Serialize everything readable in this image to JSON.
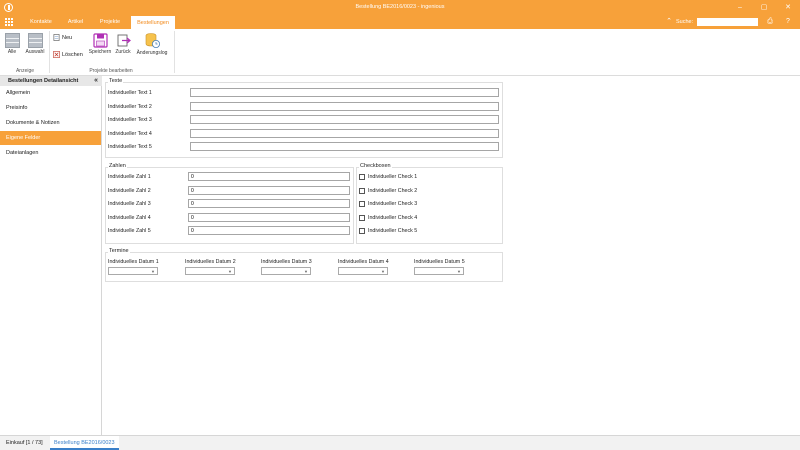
{
  "window": {
    "title": "Bestellung BE2016/0023 - ingenious",
    "controls": {
      "minimize": "‒",
      "maximize": "▢",
      "close": "✕"
    }
  },
  "menu": {
    "tabs": [
      {
        "label": "Kontakte",
        "icon": "contacts"
      },
      {
        "label": "Artikel",
        "icon": "articles"
      },
      {
        "label": "Projekte",
        "icon": "projects"
      },
      {
        "label": "Bestellungen",
        "icon": "orders",
        "active": true
      }
    ],
    "search_label": "Suche:",
    "search_value": "",
    "icons": {
      "collapse": "chevron-up-icon",
      "print": "print-icon",
      "help": "help-icon"
    }
  },
  "ribbon": {
    "alle": "Alle",
    "auswahl": "Auswahl",
    "anzeige": "Anzeige",
    "neu": "Neu",
    "loeschen": "Löschen",
    "speichern": "Speichern",
    "zurueck": "Zurück",
    "aenderungslog": "Änderungslog",
    "projekte_bearbeiten": "Projekte bearbeiten",
    "accent": "#b02fb5"
  },
  "sidebar": {
    "header": "Bestellungen Detailansicht",
    "collapse": "«",
    "items": [
      {
        "label": "Allgemein"
      },
      {
        "label": "Preisinfo"
      },
      {
        "label": "Dokumente & Notizen"
      },
      {
        "label": "Eigene Felder",
        "selected": true
      },
      {
        "label": "Dateianlagen"
      }
    ]
  },
  "texte": {
    "title": "Texte",
    "fields": [
      {
        "label": "Individueller Text 1",
        "value": ""
      },
      {
        "label": "Individueller Text 2",
        "value": ""
      },
      {
        "label": "Individueller Text 3",
        "value": ""
      },
      {
        "label": "Individueller Text 4",
        "value": ""
      },
      {
        "label": "Individueller Text 5",
        "value": ""
      }
    ]
  },
  "zahlen": {
    "title": "Zahlen",
    "fields": [
      {
        "label": "Individuelle Zahl 1",
        "value": "0"
      },
      {
        "label": "Individuelle Zahl 2",
        "value": "0"
      },
      {
        "label": "Individuelle Zahl 3",
        "value": "0"
      },
      {
        "label": "Individuelle Zahl 4",
        "value": "0"
      },
      {
        "label": "Individuelle Zahl 5",
        "value": "0"
      }
    ]
  },
  "checkboxen": {
    "title": "Checkboxen",
    "fields": [
      {
        "label": "Individueller Check 1",
        "checked": false
      },
      {
        "label": "Individueller Check 2",
        "checked": false
      },
      {
        "label": "Individueller Check 3",
        "checked": false
      },
      {
        "label": "Individueller Check 4",
        "checked": false
      },
      {
        "label": "Individueller Check 5",
        "checked": false
      }
    ]
  },
  "termine": {
    "title": "Termine",
    "fields": [
      {
        "label": "Individuelles Datum 1",
        "value": ""
      },
      {
        "label": "Individuelles Datum 2",
        "value": ""
      },
      {
        "label": "Individuelles Datum 3",
        "value": ""
      },
      {
        "label": "Individuelles Datum 4",
        "value": ""
      },
      {
        "label": "Individuelles Datum 5",
        "value": ""
      }
    ]
  },
  "status": {
    "tabs": [
      {
        "label": "Einkauf [1 / 73]"
      },
      {
        "label": "Bestellung BE2016/0023",
        "active": true
      }
    ]
  },
  "colors": {
    "accent": "#f7a13a",
    "selection": "#f7a13a",
    "active_tab_text": "#3a7fc9"
  }
}
